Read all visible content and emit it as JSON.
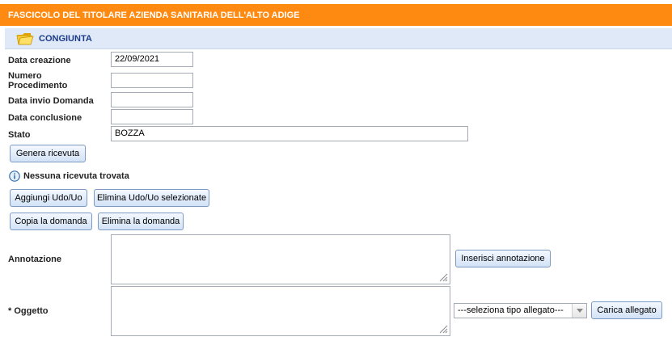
{
  "header": {
    "title": "FASCICOLO DEL TITOLARE AZIENDA SANITARIA DELL'ALTO ADIGE"
  },
  "section": {
    "title": "CONGIUNTA",
    "icon": "folder-icon"
  },
  "form": {
    "data_creazione": {
      "label": "Data creazione",
      "value": "22/09/2021"
    },
    "numero_procedimento": {
      "label_line1": "Numero",
      "label_line2": "Procedimento",
      "value": ""
    },
    "data_invio_domanda": {
      "label": "Data invio Domanda",
      "value": ""
    },
    "data_conclusione": {
      "label": "Data conclusione",
      "value": ""
    },
    "stato": {
      "label": "Stato",
      "value": "BOZZA"
    }
  },
  "buttons": {
    "genera_ricevuta": "Genera ricevuta",
    "aggiungi_udo": "Aggiungi Udo/Uo",
    "elimina_udo": "Elimina Udo/Uo selezionate",
    "copia_domanda": "Copia la domanda",
    "elimina_domanda": "Elimina la domanda",
    "inserisci_annotazione": "Inserisci annotazione",
    "carica_allegato": "Carica allegato"
  },
  "ricevuta": {
    "message": "Nessuna ricevuta trovata",
    "icon": "info-icon"
  },
  "annotazione": {
    "label": "Annotazione",
    "value": ""
  },
  "oggetto": {
    "label": "* Oggetto",
    "value": ""
  },
  "tipo_allegato": {
    "selected": "---seleziona tipo allegato---"
  },
  "colors": {
    "title_bar": "#ff8a12",
    "section_bar": "#dfe9f7",
    "section_text": "#1b3b8a",
    "button_border": "#7d9ac2"
  }
}
